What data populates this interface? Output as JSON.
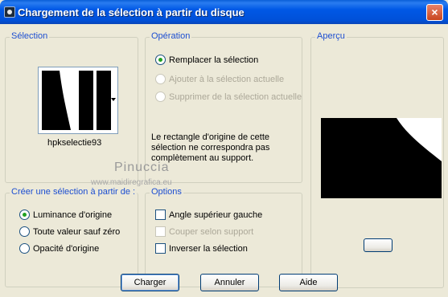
{
  "window": {
    "title": "Chargement de la sélection à partir du disque",
    "close_label": "×"
  },
  "selection_group": {
    "label": "Sélection",
    "selected_name": "hpkselectie93"
  },
  "operation_group": {
    "label": "Opération",
    "options": [
      {
        "label": "Remplacer la sélection",
        "checked": true,
        "enabled": true
      },
      {
        "label": "Ajouter à la sélection actuelle",
        "checked": false,
        "enabled": false
      },
      {
        "label": "Supprimer de la sélection actuelle",
        "checked": false,
        "enabled": false
      }
    ],
    "info_text_lines": [
      "Le rectangle d'origine de cette",
      "sélection ne correspondra pas",
      "complètement au support."
    ]
  },
  "preview_group": {
    "label": "Aperçu"
  },
  "create_group": {
    "label": "Créer une sélection à partir de :",
    "options": [
      {
        "label": "Luminance d'origine",
        "checked": true
      },
      {
        "label": "Toute valeur sauf zéro",
        "checked": false
      },
      {
        "label": "Opacité d'origine",
        "checked": false
      }
    ]
  },
  "options_group": {
    "label": "Options",
    "items": [
      {
        "label": "Angle supérieur gauche",
        "checked": false,
        "enabled": true
      },
      {
        "label": "Couper selon support",
        "checked": false,
        "enabled": false
      },
      {
        "label": "Inverser la sélection",
        "checked": false,
        "enabled": true
      }
    ]
  },
  "watermark": {
    "name": "Pinuccia",
    "url": "www.maidiregrafica.eu"
  },
  "buttons": {
    "load": "Charger",
    "cancel": "Annuler",
    "help": "Aide"
  },
  "colors": {
    "title_bar": "#0054e3",
    "group_label": "#1c4ed1",
    "dialog_bg": "#ece9d8",
    "radio_dot": "#21a121"
  }
}
